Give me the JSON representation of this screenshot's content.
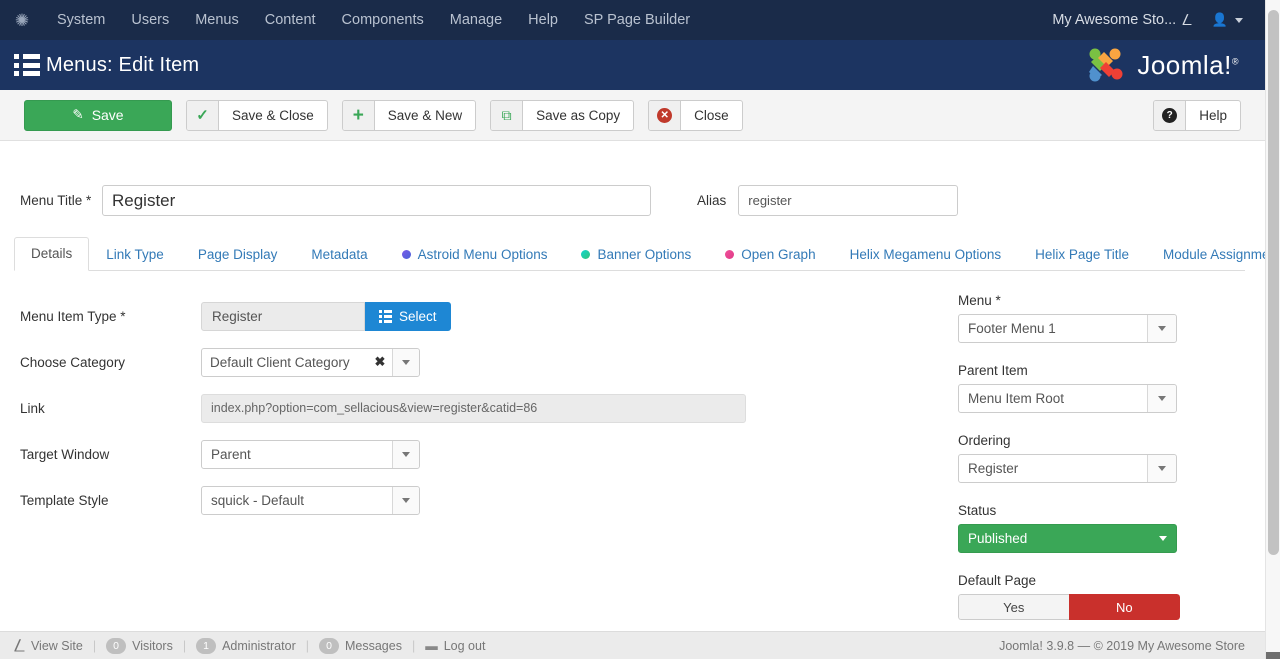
{
  "topbar": {
    "brand_icon": "joomla-logo-icon",
    "nav": [
      {
        "label": "System"
      },
      {
        "label": "Users"
      },
      {
        "label": "Menus"
      },
      {
        "label": "Content"
      },
      {
        "label": "Components"
      },
      {
        "label": "Manage"
      },
      {
        "label": "Help"
      },
      {
        "label": "SP Page Builder"
      }
    ],
    "site_name": "My Awesome Sto...",
    "site_icon": "external-link-icon",
    "user_icon": "user-icon"
  },
  "header": {
    "title": "Menus: Edit Item",
    "icon": "list-view-icon",
    "logo_text": "Joomla!",
    "logo_sup": "®"
  },
  "toolbar": {
    "save_label": "Save",
    "save_close_label": "Save & Close",
    "save_new_label": "Save & New",
    "save_copy_label": "Save as Copy",
    "close_label": "Close",
    "help_label": "Help",
    "colors": {
      "save_green": "#3aa757",
      "close_red": "#c0392b"
    }
  },
  "form": {
    "menu_title_label": "Menu Title *",
    "menu_title_value": "Register",
    "alias_label": "Alias",
    "alias_value": "register"
  },
  "tabs": [
    {
      "label": "Details",
      "active": true,
      "dot": ""
    },
    {
      "label": "Link Type",
      "active": false,
      "dot": ""
    },
    {
      "label": "Page Display",
      "active": false,
      "dot": ""
    },
    {
      "label": "Metadata",
      "active": false,
      "dot": ""
    },
    {
      "label": "Astroid Menu Options",
      "active": false,
      "dot": "#5b51d8"
    },
    {
      "label": "Banner Options",
      "active": false,
      "dot": "#14c8bd"
    },
    {
      "label": "Open Graph",
      "active": false,
      "dot": "#ed4c8f"
    },
    {
      "label": "Helix Megamenu Options",
      "active": false,
      "dot": ""
    },
    {
      "label": "Helix Page Title",
      "active": false,
      "dot": ""
    },
    {
      "label": "Module Assignment",
      "active": false,
      "dot": ""
    }
  ],
  "details": {
    "menu_item_type_label": "Menu Item Type *",
    "menu_item_type_value": "Register",
    "select_button_label": "Select",
    "choose_category_label": "Choose Category",
    "choose_category_value": "Default Client Category",
    "clear_glyph": "✖",
    "link_label": "Link",
    "link_value": "index.php?option=com_sellacious&view=register&catid=86",
    "target_window_label": "Target Window",
    "target_window_value": "Parent",
    "template_style_label": "Template Style",
    "template_style_value": "squick - Default"
  },
  "sidebar": {
    "menu_label": "Menu *",
    "menu_value": "Footer Menu 1",
    "parent_item_label": "Parent Item",
    "parent_item_value": "Menu Item Root",
    "ordering_label": "Ordering",
    "ordering_value": "Register",
    "status_label": "Status",
    "status_value": "Published",
    "status_color": "#3aa757",
    "default_page_label": "Default Page",
    "default_yes_label": "Yes",
    "default_no_label": "No",
    "default_no_color": "#c9302c"
  },
  "statusbar": {
    "view_site_label": "View Site",
    "view_site_icon": "external-link-icon",
    "visitors_count": "0",
    "visitors_label": "Visitors",
    "admin_count": "1",
    "admin_label": "Administrator",
    "messages_count": "0",
    "messages_label": "Messages",
    "logout_label": "Log out",
    "logout_icon": "minus-icon",
    "copyright": "Joomla! 3.9.8  —  © 2019 My Awesome Store"
  }
}
